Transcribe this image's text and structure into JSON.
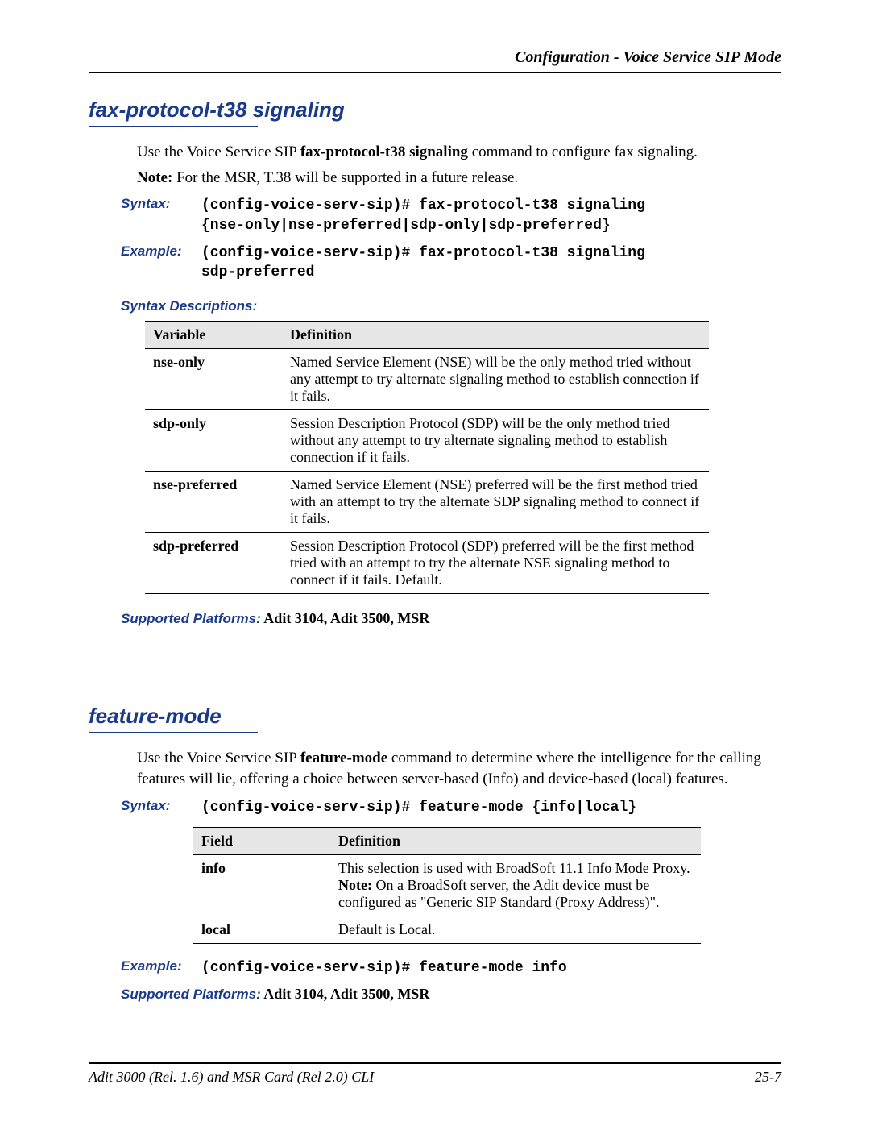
{
  "header": {
    "running_head": "Configuration - Voice Service SIP Mode"
  },
  "section1": {
    "title": "fax-protocol-t38 signaling",
    "intro_prefix": "Use the Voice Service SIP ",
    "intro_bold": "fax-protocol-t38 signaling",
    "intro_suffix": " command to configure fax signaling.",
    "note_label": "Note:",
    "note_text": "  For the MSR, T.38 will be supported in a future release.",
    "syntax_label": "Syntax:",
    "syntax_command": "(config-voice-serv-sip)# fax-protocol-t38 signaling\n{nse-only|nse-preferred|sdp-only|sdp-preferred}",
    "example_label": "Example:",
    "example_command": "(config-voice-serv-sip)# fax-protocol-t38 signaling\nsdp-preferred",
    "descriptions_label": "Syntax Descriptions:",
    "table": {
      "head_var": "Variable",
      "head_def": "Definition",
      "rows": [
        {
          "var": "nse-only",
          "def": "Named Service Element (NSE) will be the only method tried without any attempt to try alternate signaling method to establish connection if it fails."
        },
        {
          "var": "sdp-only",
          "def": "Session Description Protocol (SDP) will be the only method tried without any attempt to try alternate signaling method to establish connection if it fails."
        },
        {
          "var": "nse-preferred",
          "def": "Named Service Element (NSE) preferred will be the first method tried with an attempt to try the alternate SDP signaling method to connect if it fails."
        },
        {
          "var": "sdp-preferred",
          "def": "Session Description Protocol (SDP) preferred will be the first method tried with an attempt to try the alternate NSE signaling method to connect if it fails. Default."
        }
      ]
    },
    "supported_label": "Supported Platforms:",
    "supported_value": "  Adit 3104, Adit 3500, MSR"
  },
  "section2": {
    "title": "feature-mode",
    "intro_prefix": "Use the Voice Service SIP ",
    "intro_bold": "feature-mode",
    "intro_suffix": " command to determine where the intelligence for the calling features will lie, offering a choice between server-based (Info) and device-based (local) features.",
    "syntax_label": "Syntax:",
    "syntax_command": "(config-voice-serv-sip)# feature-mode {info|local}",
    "table": {
      "head_var": "Field",
      "head_def": "Definition",
      "rows": [
        {
          "var": "info",
          "def_prefix": "This selection is used with BroadSoft 11.1 Info Mode Proxy. ",
          "def_notelabel": "Note:",
          "def_suffix": " On a BroadSoft server, the Adit device must be configured as \"Generic SIP Standard (Proxy Address)\"."
        },
        {
          "var": "local",
          "def_prefix": "Default is Local.",
          "def_notelabel": "",
          "def_suffix": ""
        }
      ]
    },
    "example_label": "Example:",
    "example_command": "(config-voice-serv-sip)# feature-mode info",
    "supported_label": "Supported Platforms:",
    "supported_value": "  Adit 3104, Adit 3500, MSR"
  },
  "footer": {
    "left": "Adit 3000 (Rel. 1.6) and MSR Card (Rel 2.0) CLI",
    "right": "25-7"
  }
}
